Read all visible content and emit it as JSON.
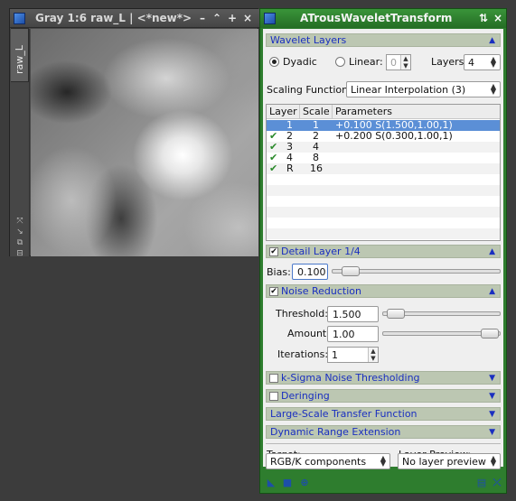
{
  "image_window": {
    "title": "Gray 1:6 raw_L | <*new*>",
    "tab_label": "raw_L",
    "buttons": [
      "–",
      "⌃",
      "+",
      "×"
    ]
  },
  "dialog": {
    "title": "ATrousWaveletTransform",
    "wavelet_layers": {
      "header": "Wavelet Layers",
      "dyadic_label": "Dyadic",
      "linear_label": "Linear:",
      "linear_value": "0",
      "layers_label": "Layers:",
      "layers_value": "4",
      "scaling_label": "Scaling Function:",
      "scaling_value": "Linear Interpolation (3)",
      "table": {
        "headers": [
          "Layer",
          "Scale",
          "Parameters"
        ],
        "rows": [
          {
            "layer": "1",
            "scale": "1",
            "params": "+0.100 S(1.500,1.00,1)",
            "checked": false,
            "selected": true
          },
          {
            "layer": "2",
            "scale": "2",
            "params": "+0.200 S(0.300,1.00,1)",
            "checked": true,
            "selected": false
          },
          {
            "layer": "3",
            "scale": "4",
            "params": "",
            "checked": true,
            "selected": false
          },
          {
            "layer": "4",
            "scale": "8",
            "params": "",
            "checked": true,
            "selected": false
          },
          {
            "layer": "R",
            "scale": "16",
            "params": "",
            "checked": true,
            "selected": false
          }
        ]
      }
    },
    "detail_layer": {
      "header": "Detail Layer 1/4",
      "bias_label": "Bias:",
      "bias_value": "0.100"
    },
    "noise_reduction": {
      "header": "Noise Reduction",
      "threshold_label": "Threshold:",
      "threshold_value": "1.500",
      "amount_label": "Amount:",
      "amount_value": "1.00",
      "iterations_label": "Iterations:",
      "iterations_value": "1"
    },
    "collapsed_sections": {
      "ksigma": "k-Sigma Noise Thresholding",
      "deringing": "Deringing",
      "lstf": "Large-Scale Transfer Function",
      "dre": "Dynamic Range Extension"
    },
    "target_label": "Target:",
    "target_value": "RGB/K components",
    "layer_preview_label": "Layer Preview:",
    "layer_preview_value": "No layer preview"
  },
  "colors": {
    "dialog_frame": "#2e7d2e",
    "section_text": "#1a2fc0",
    "selection": "#5b8fd6",
    "check": "#2b8a2b"
  }
}
